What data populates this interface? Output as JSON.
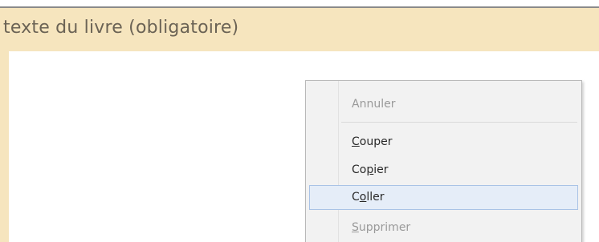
{
  "field": {
    "label": "texte du livre (obligatoire)"
  },
  "context_menu": {
    "items": [
      {
        "first": "",
        "underlined": "",
        "rest": "Annuler",
        "disabled": true
      },
      {
        "first": "",
        "underlined": "C",
        "rest": "ouper",
        "disabled": false
      },
      {
        "first": "Co",
        "underlined": "p",
        "rest": "ier",
        "disabled": false
      },
      {
        "first": "C",
        "underlined": "o",
        "rest": "ller",
        "disabled": false,
        "highlighted": true
      },
      {
        "first": "",
        "underlined": "S",
        "rest": "upprimer",
        "disabled": true
      }
    ]
  },
  "colors": {
    "header_bg": "#f6e5be",
    "menu_bg": "#f2f2f2",
    "highlight_bg": "#e5edf8",
    "highlight_border": "#a9c3e6"
  }
}
